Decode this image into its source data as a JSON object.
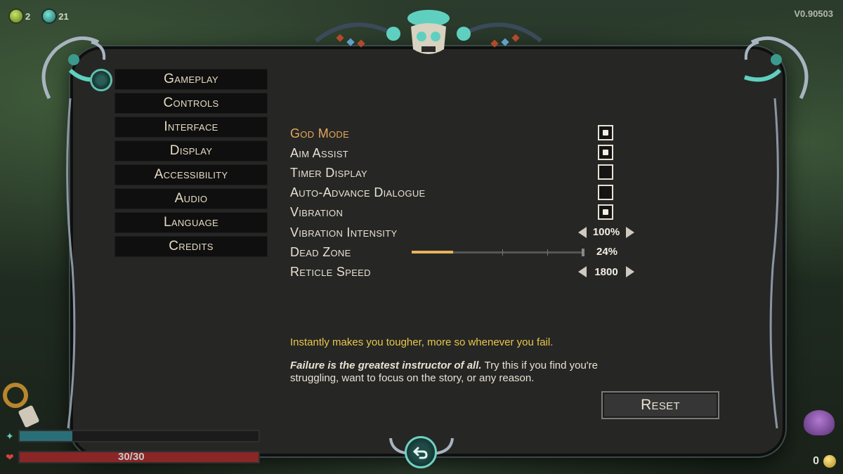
{
  "hud": {
    "resource1_count": "2",
    "resource2_count": "21",
    "version": "V0.90503",
    "health_text": "30/30",
    "gold_count": "0"
  },
  "menu": {
    "items": [
      {
        "label": "Gameplay"
      },
      {
        "label": "Controls"
      },
      {
        "label": "Interface"
      },
      {
        "label": "Display"
      },
      {
        "label": "Accessibility"
      },
      {
        "label": "Audio"
      },
      {
        "label": "Language"
      },
      {
        "label": "Credits"
      }
    ]
  },
  "settings": {
    "god_mode": {
      "label": "God Mode",
      "checked": true
    },
    "aim_assist": {
      "label": "Aim Assist",
      "checked": true
    },
    "timer_display": {
      "label": "Timer Display",
      "checked": false
    },
    "auto_advance": {
      "label": "Auto-Advance Dialogue",
      "checked": false
    },
    "vibration": {
      "label": "Vibration",
      "checked": true
    },
    "vibration_intensity": {
      "label": "Vibration Intensity",
      "value": "100%"
    },
    "dead_zone": {
      "label": "Dead Zone",
      "value": "24%",
      "fraction": 0.24
    },
    "reticle_speed": {
      "label": "Reticle Speed",
      "value": "1800"
    }
  },
  "description": {
    "line1": "Instantly makes you tougher, more so whenever you fail.",
    "emphasis": "Failure is the greatest instructor of all.",
    "rest": " Try this if you find you're struggling, want to focus on the story, or any reason."
  },
  "buttons": {
    "reset": "Reset"
  },
  "colors": {
    "accent_selected": "#e6a85a",
    "description_yellow": "#e8c84a",
    "ornament_teal": "#5fd0c0"
  }
}
